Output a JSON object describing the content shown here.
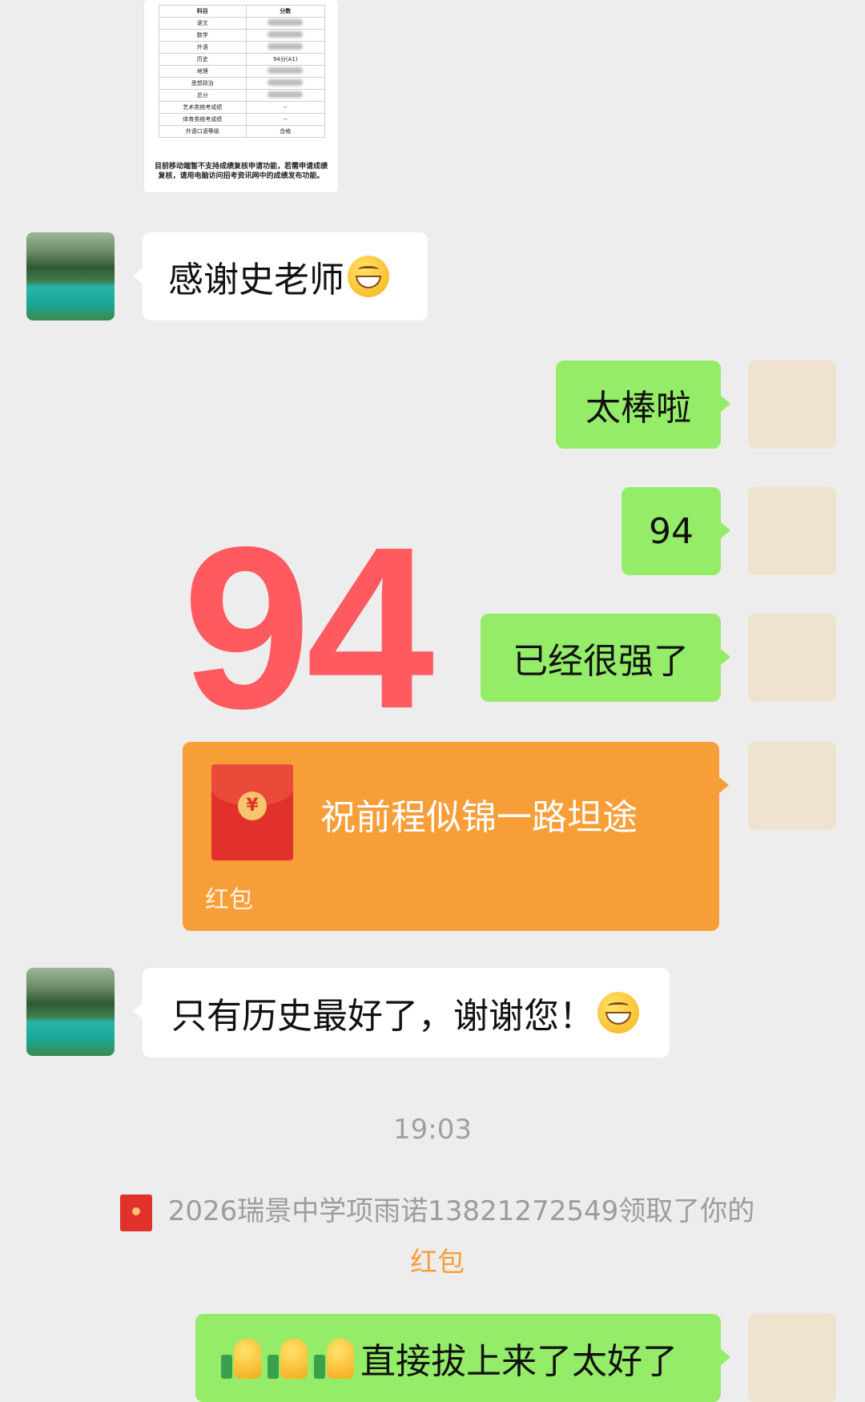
{
  "score_image": {
    "header": [
      "科目",
      "分数"
    ],
    "rows": [
      [
        "语文",
        ""
      ],
      [
        "数学",
        ""
      ],
      [
        "外语",
        ""
      ],
      [
        "历史",
        "94分(A1)"
      ],
      [
        "地理",
        ""
      ],
      [
        "思想政治",
        ""
      ],
      [
        "总分",
        ""
      ],
      [
        "艺术类统考成绩",
        "--"
      ],
      [
        "体育类统考成绩",
        "--"
      ],
      [
        "外语口语等级",
        "合格"
      ]
    ],
    "note": "目前移动端暂不支持成绩复核申请功能，若需申请成绩复核，请用电脑访问招考资讯网中的成绩发布功能。"
  },
  "messages": {
    "m1": "感谢史老师",
    "m2": "太棒啦",
    "m3": "94",
    "m4": "已经很强了",
    "m5": "只有历史最好了，谢谢您！",
    "m6": "直接拔上来了太好了"
  },
  "overlay_text": "94",
  "red_packet": {
    "title": "祝前程似锦一路坦途",
    "label": "红包",
    "coin_symbol": "¥"
  },
  "timestamp": "19:03",
  "system_notice": {
    "text": "2026瑞景中学项雨诺13821272549领取了你的",
    "highlight": "红包"
  },
  "colors": {
    "background": "#ededed",
    "green_bubble": "#95ec69",
    "red_packet": "#f79e38",
    "big_number": "#ff5a5f"
  },
  "icons": [
    "grin-emoji-icon",
    "thumbs-up-icon",
    "red-envelope-icon"
  ]
}
